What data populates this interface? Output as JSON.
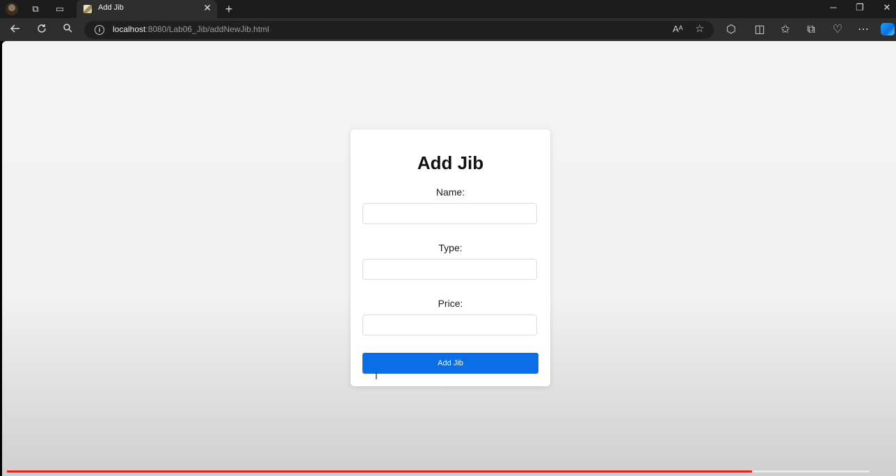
{
  "browser": {
    "tab_title": "Add Jib",
    "tab_close": "✕",
    "new_tab": "+",
    "url_host": "localhost",
    "url_rest": ":8080/Lab06_Jib/addNewJib.html",
    "window_controls": {
      "minimize": "─",
      "restore": "❐",
      "close": "✕"
    },
    "icons": {
      "back": "back-arrow-icon",
      "refresh": "refresh-icon",
      "search": "search-icon",
      "info": "info-icon",
      "read_aloud": "read-aloud-icon",
      "favorite": "star-icon",
      "extensions": "puzzle-icon",
      "split_screen": "split-screen-icon",
      "favorites": "favorites-icon",
      "collections": "collections-icon",
      "performance": "heart-pulse-icon",
      "more": "more-icon",
      "copilot": "copilot-icon"
    }
  },
  "form": {
    "title": "Add Jib",
    "fields": [
      {
        "label": "Name:",
        "value": ""
      },
      {
        "label": "Type:",
        "value": ""
      },
      {
        "label": "Price:",
        "value": ""
      }
    ],
    "submit_label": "Add Jib"
  },
  "colors": {
    "button": "#0a6ee6",
    "progress": "#e62117"
  },
  "video_progress": 0.864
}
